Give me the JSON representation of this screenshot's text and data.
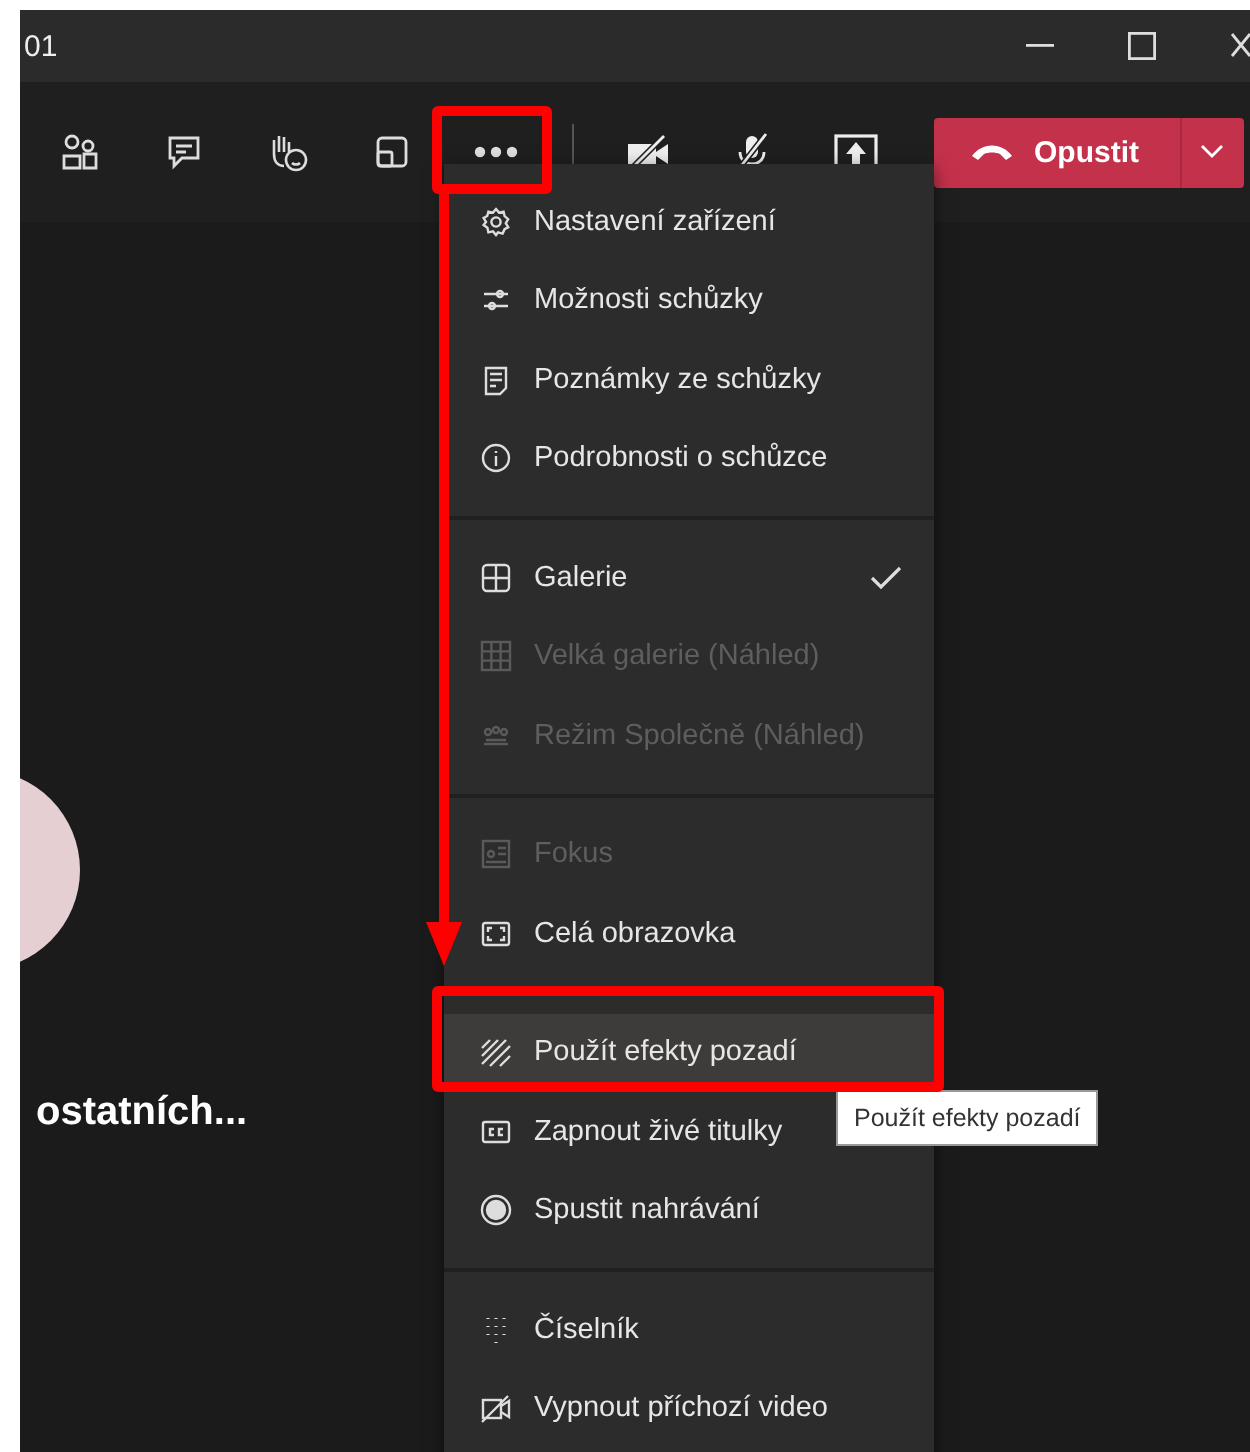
{
  "window": {
    "title": "01"
  },
  "toolbar": {
    "leave_button": {
      "label": "Opustit"
    }
  },
  "stage": {
    "caption": "ostatních..."
  },
  "menu": {
    "sections": [
      {
        "items": [
          {
            "label": "Nastavení zařízení",
            "disabled": false,
            "checked": false,
            "highlighted": false
          },
          {
            "label": "Možnosti schůzky",
            "disabled": false,
            "checked": false,
            "highlighted": false
          },
          {
            "label": "Poznámky ze schůzky",
            "disabled": false,
            "checked": false,
            "highlighted": false
          },
          {
            "label": "Podrobnosti o schůzce",
            "disabled": false,
            "checked": false,
            "highlighted": false
          }
        ]
      },
      {
        "items": [
          {
            "label": "Galerie",
            "disabled": false,
            "checked": true,
            "highlighted": false
          },
          {
            "label": "Velká galerie (Náhled)",
            "disabled": true,
            "checked": false,
            "highlighted": false
          },
          {
            "label": "Režim Společně (Náhled)",
            "disabled": true,
            "checked": false,
            "highlighted": false
          }
        ]
      },
      {
        "items": [
          {
            "label": "Fokus",
            "disabled": true,
            "checked": false,
            "highlighted": false
          },
          {
            "label": "Celá obrazovka",
            "disabled": false,
            "checked": false,
            "highlighted": false
          }
        ]
      },
      {
        "items": [
          {
            "label": "Použít efekty pozadí",
            "disabled": false,
            "checked": false,
            "highlighted": true
          },
          {
            "label": "Zapnout živé titulky",
            "disabled": false,
            "checked": false,
            "highlighted": false
          },
          {
            "label": "Spustit nahrávání",
            "disabled": false,
            "checked": false,
            "highlighted": false
          }
        ]
      },
      {
        "items": [
          {
            "label": "Číselník",
            "disabled": false,
            "checked": false,
            "highlighted": false
          },
          {
            "label": "Vypnout příchozí video",
            "disabled": false,
            "checked": false,
            "highlighted": false
          }
        ]
      }
    ]
  },
  "tooltip": {
    "text": "Použít efekty pozadí"
  }
}
